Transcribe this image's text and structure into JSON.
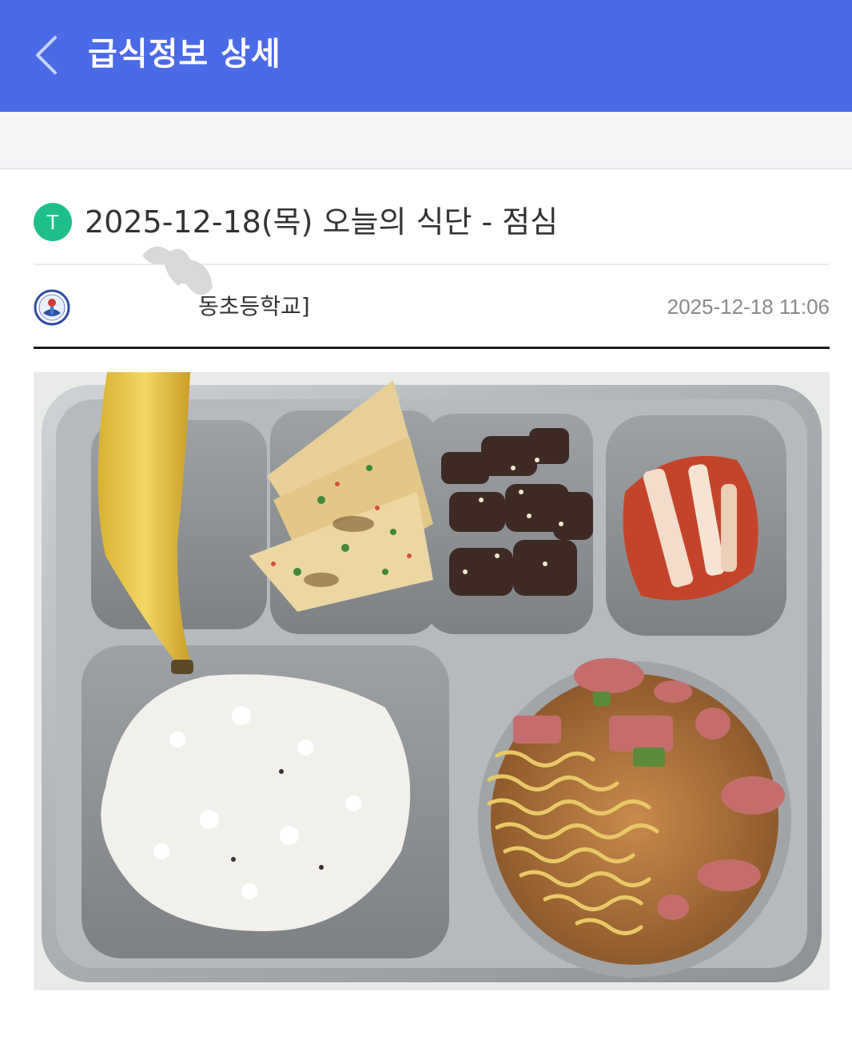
{
  "app_bar": {
    "title": "급식정보 상세",
    "back_icon": "chevron-left-icon",
    "color": "#4a6ae6"
  },
  "post": {
    "badge": "T",
    "badge_color": "#1fbf8c",
    "title": "2025-12-18(목) 오늘의 식단 - 점심",
    "author": "동초등학교]",
    "timestamp": "2025-12-18 11:06"
  },
  "photo": {
    "subject": "meal tray",
    "items": [
      "banana",
      "vegetable pancake",
      "bulgogi",
      "kimchi",
      "rice",
      "budae-jjigae with ramen"
    ]
  }
}
